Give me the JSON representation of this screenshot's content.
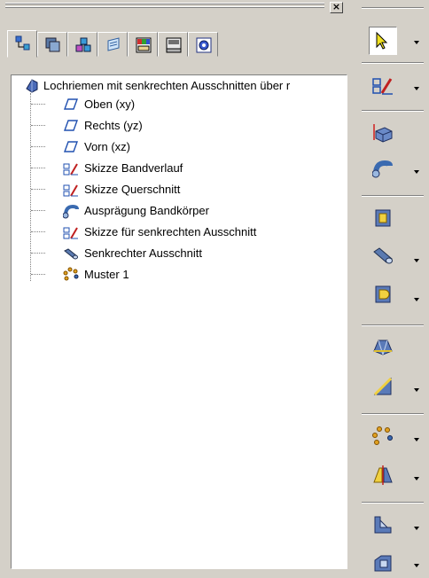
{
  "close_glyph": "×",
  "tabs": [
    {
      "icon": "tree-structure-icon",
      "active": true
    },
    {
      "icon": "layers-stack-icon"
    },
    {
      "icon": "assembly-icon"
    },
    {
      "icon": "sheets-icon"
    },
    {
      "icon": "color-palette-icon"
    },
    {
      "icon": "document-manager-icon"
    },
    {
      "icon": "settings-icon"
    }
  ],
  "tree": {
    "root_label": "Lochriemen mit senkrechten Ausschnitten über r",
    "items": [
      {
        "label": "Oben (xy)",
        "icon": "plane-icon"
      },
      {
        "label": "Rechts (yz)",
        "icon": "plane-icon"
      },
      {
        "label": "Vorn (xz)",
        "icon": "plane-icon"
      },
      {
        "label": "Skizze Bandverlauf",
        "icon": "sketch-icon"
      },
      {
        "label": "Skizze Querschnitt",
        "icon": "sketch-icon"
      },
      {
        "label": "Ausprägung Bandkörper",
        "icon": "sweep-icon"
      },
      {
        "label": "Skizze für senkrechten Ausschnitt",
        "icon": "sketch-icon"
      },
      {
        "label": "Senkrechter Ausschnitt",
        "icon": "cut-icon"
      },
      {
        "label": "Muster 1",
        "icon": "pattern-icon"
      }
    ]
  },
  "toolbar": [
    {
      "icon": "select-arrow-icon",
      "dropdown": true,
      "pressed": true
    },
    {
      "icon": "sketch-icon",
      "dropdown": true
    },
    {
      "icon": "extrude-icon",
      "dropdown": false
    },
    {
      "icon": "sweep-icon",
      "dropdown": true
    },
    {
      "icon": "hole-icon",
      "dropdown": false
    },
    {
      "icon": "cylinder-cut-icon",
      "dropdown": true
    },
    {
      "icon": "pocket-icon",
      "dropdown": true
    },
    {
      "icon": "loft-icon",
      "dropdown": false
    },
    {
      "icon": "chamfer-icon",
      "dropdown": true
    },
    {
      "icon": "pattern-icon",
      "dropdown": true
    },
    {
      "icon": "mirror-icon",
      "dropdown": true
    },
    {
      "icon": "rib-icon",
      "dropdown": true
    },
    {
      "icon": "shell-icon",
      "dropdown": true
    }
  ]
}
